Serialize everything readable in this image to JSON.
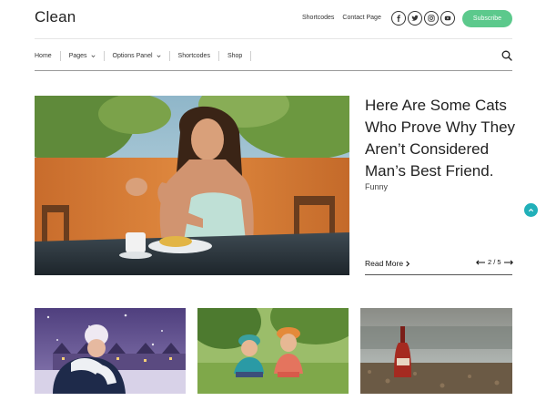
{
  "header": {
    "logo": "Clean",
    "links": [
      "Shortcodes",
      "Contact Page"
    ],
    "social_icons": [
      "facebook-icon",
      "twitter-icon",
      "instagram-icon",
      "youtube-icon"
    ],
    "subscribe_label": "Subscribe",
    "accent": "#5cc98c"
  },
  "nav": {
    "items": [
      {
        "label": "Home",
        "dropdown": false
      },
      {
        "label": "Pages",
        "dropdown": true
      },
      {
        "label": "Options Panel",
        "dropdown": true
      },
      {
        "label": "Shortcodes",
        "dropdown": false
      },
      {
        "label": "Shop",
        "dropdown": false
      }
    ],
    "search_icon": "search-icon"
  },
  "hero": {
    "title": "Here Are Some Cats Who Prove Why They Aren’t Considered Man’s Best Friend.",
    "category": "Funny",
    "read_more": "Read More",
    "pager": "2 / 5"
  },
  "scroll_top": {
    "icon": "chevron-up-icon",
    "color": "#21b0b9"
  }
}
